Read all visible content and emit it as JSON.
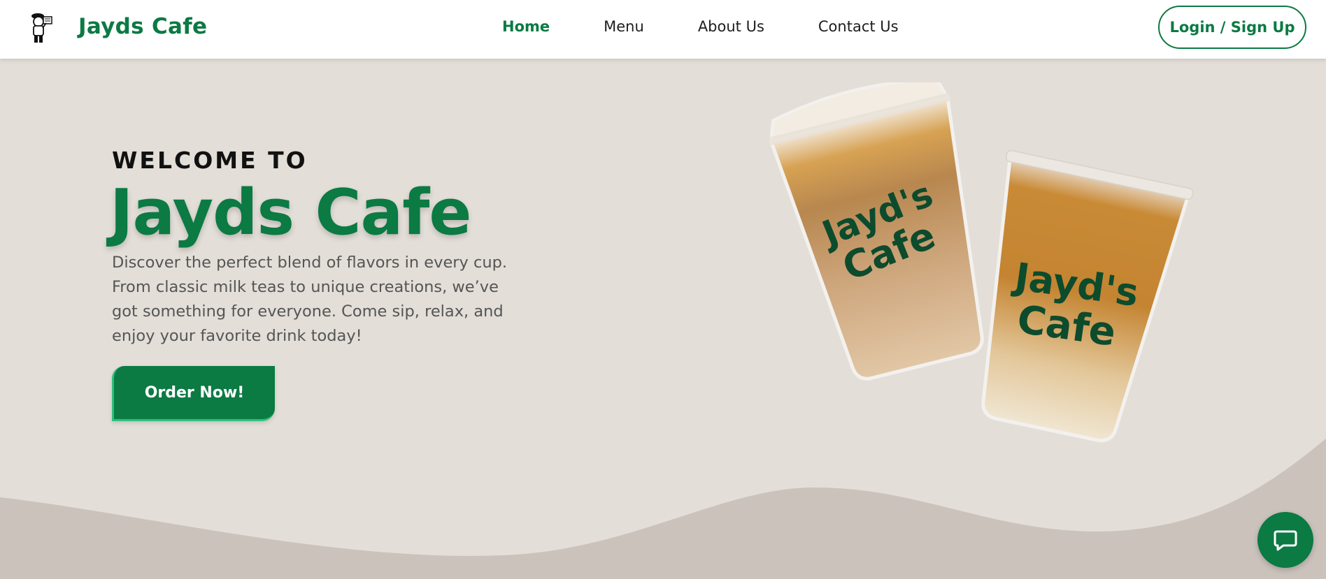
{
  "theme": {
    "brand_color": "#0b7a43",
    "background": "#e3ded8",
    "wave_color": "#cbc2bc"
  },
  "header": {
    "logo_icon": "mascot-logo-icon",
    "brand_name": "Jayds Cafe",
    "nav": [
      {
        "label": "Home",
        "active": true
      },
      {
        "label": "Menu",
        "active": false
      },
      {
        "label": "About Us",
        "active": false
      },
      {
        "label": "Contact Us",
        "active": false
      }
    ],
    "login_label": "Login / Sign Up"
  },
  "hero": {
    "eyebrow": "WELCOME TO",
    "title": "Jayds Cafe",
    "description": "Discover the perfect blend of flavors in every cup. From classic milk teas to unique creations, we’ve got something for everyone. Come sip, relax, and enjoy your favorite drink today!",
    "cta_label": "Order Now!",
    "image": {
      "icon": "iced-coffee-cups-image",
      "cup_text_line1": "Jayd's",
      "cup_text_line2": "Cafe"
    }
  },
  "chat": {
    "icon": "chat-bubble-icon"
  }
}
